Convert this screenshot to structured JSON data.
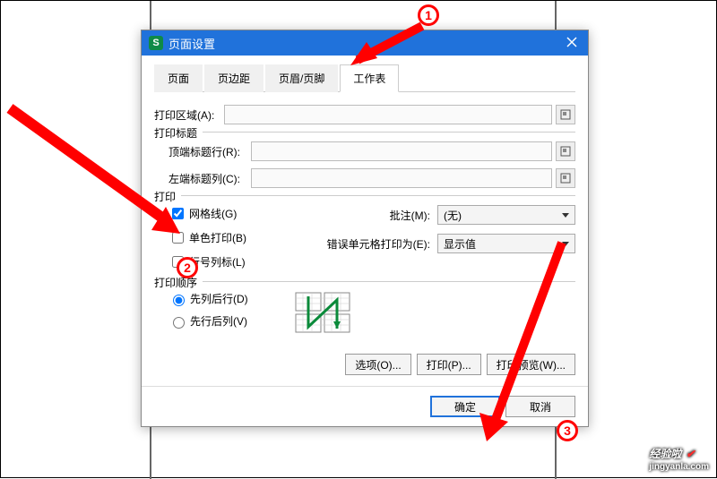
{
  "dialog": {
    "title": "页面设置",
    "logo_text": "S"
  },
  "tabs": [
    "页面",
    "页边距",
    "页眉/页脚",
    "工作表"
  ],
  "active_tab_index": 3,
  "print_area": {
    "label": "打印区域(A):",
    "value": ""
  },
  "print_titles": {
    "group": "打印标题",
    "top_row": {
      "label": "顶端标题行(R):",
      "value": ""
    },
    "left_col": {
      "label": "左端标题列(C):",
      "value": ""
    }
  },
  "print": {
    "group": "打印",
    "gridlines": {
      "label": "网格线(G)",
      "checked": true
    },
    "mono": {
      "label": "单色打印(B)",
      "checked": false
    },
    "headings": {
      "label": "行号列标(L)",
      "checked": false
    },
    "comments": {
      "label": "批注(M):",
      "value": "(无)"
    },
    "errors": {
      "label": "错误单元格打印为(E):",
      "value": "显示值"
    }
  },
  "order": {
    "group": "打印顺序",
    "down_over": "先列后行(D)",
    "over_down": "先行后列(V)",
    "selected": "down_over"
  },
  "buttons": {
    "options": "选项(O)...",
    "print": "打印(P)...",
    "preview": "打印预览(W)...",
    "ok": "确定",
    "cancel": "取消"
  },
  "markers": {
    "m1": "1",
    "m2": "2",
    "m3": "3"
  },
  "watermark": {
    "title": "经验啦",
    "sub": "jingyanla.com"
  }
}
